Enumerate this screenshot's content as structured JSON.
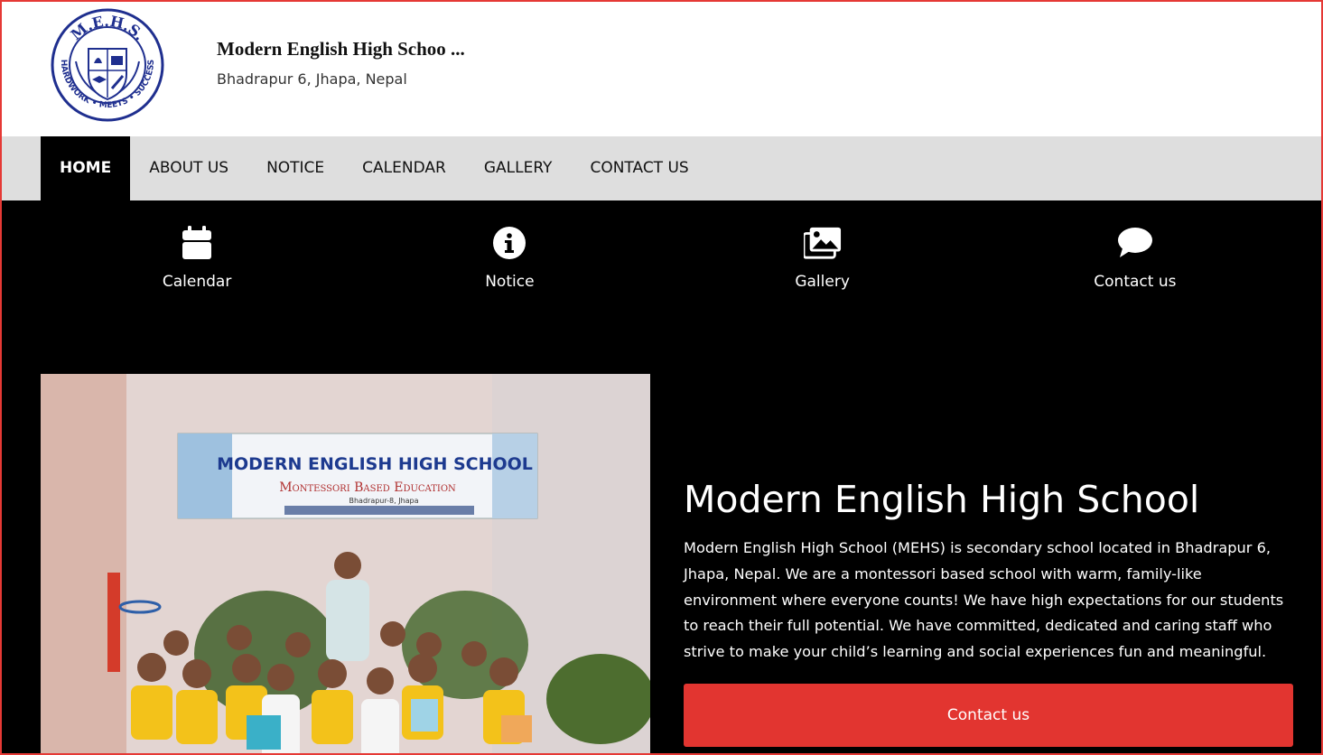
{
  "header": {
    "logo": {
      "top_text": "M.E.H.S.",
      "ring_text": "HARDWORK • MEETS • SUCCESS"
    },
    "site_name": "Modern English High Schoo ...",
    "address": "Bhadrapur 6, Jhapa, Nepal"
  },
  "nav": {
    "items": [
      {
        "label": "HOME",
        "active": true
      },
      {
        "label": "ABOUT US"
      },
      {
        "label": "NOTICE"
      },
      {
        "label": "CALENDAR"
      },
      {
        "label": "GALLERY"
      },
      {
        "label": "CONTACT US"
      }
    ]
  },
  "quick_links": [
    {
      "label": "Calendar",
      "icon": "calendar-icon"
    },
    {
      "label": "Notice",
      "icon": "info-icon"
    },
    {
      "label": "Gallery",
      "icon": "images-icon"
    },
    {
      "label": "Contact us",
      "icon": "chat-bubble-icon"
    }
  ],
  "photo": {
    "sign_title": "MODERN ENGLISH HIGH SCHOOL",
    "sign_subtitle": "Montessori Based Education",
    "sign_location": "Bhadrapur-8, Jhapa"
  },
  "intro": {
    "title": "Modern English High School",
    "body": "Modern English High School (MEHS) is secondary school located in Bhadrapur 6, Jhapa, Nepal. We are a montessori based school with warm, family-like environment where everyone counts! We have high expectations for our students to reach their full potential. We have committed, dedicated and caring staff who strive to make your child’s learning and social experiences fun and meaningful.",
    "button_label": "Contact us"
  },
  "colors": {
    "accent_red": "#e23530",
    "nav_bg": "#dedede",
    "main_bg": "#000000",
    "logo_blue": "#1f2f8f"
  }
}
